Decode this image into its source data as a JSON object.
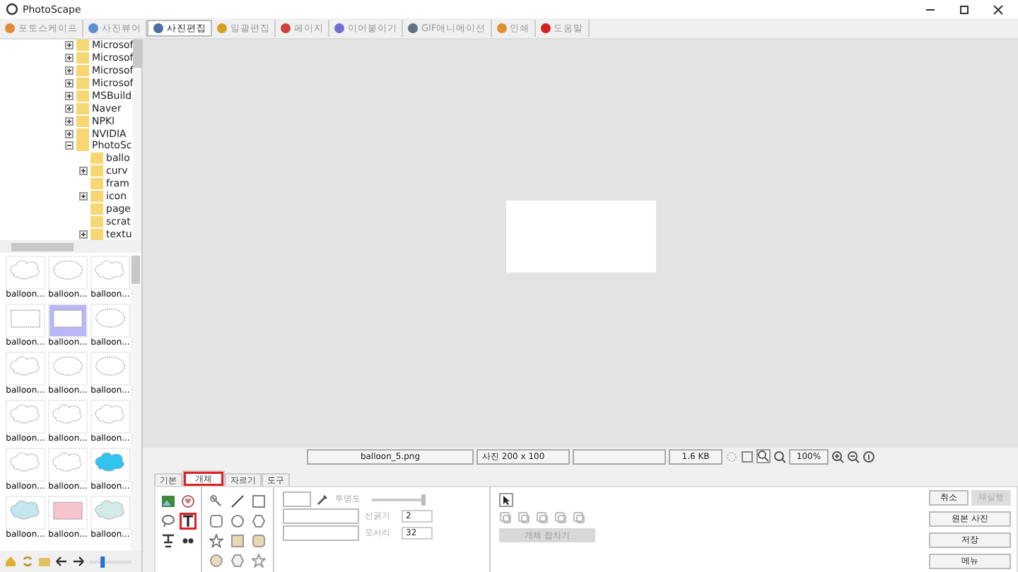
{
  "window": {
    "title": "PhotoScape"
  },
  "main_tabs": [
    {
      "label": "포토스케이프",
      "selected": false
    },
    {
      "label": "사진뷰어",
      "selected": false
    },
    {
      "label": "사진편집",
      "selected": true
    },
    {
      "label": "일괄편집",
      "selected": false
    },
    {
      "label": "페이지",
      "selected": false
    },
    {
      "label": "이어붙이기",
      "selected": false
    },
    {
      "label": "GIF애니메이션",
      "selected": false
    },
    {
      "label": "인쇄",
      "selected": false
    },
    {
      "label": "도움말",
      "selected": false
    }
  ],
  "folder_tree": [
    {
      "label": "Microsof",
      "kind": "collapsed"
    },
    {
      "label": "Microsof",
      "kind": "collapsed"
    },
    {
      "label": "Microsof",
      "kind": "collapsed"
    },
    {
      "label": "Microsof",
      "kind": "collapsed"
    },
    {
      "label": "MSBuild",
      "kind": "collapsed"
    },
    {
      "label": "Naver",
      "kind": "collapsed"
    },
    {
      "label": "NPKI",
      "kind": "collapsed"
    },
    {
      "label": "NVIDIA",
      "kind": "collapsed"
    },
    {
      "label": "PhotoSc",
      "kind": "expanded",
      "children": [
        {
          "label": "ballo",
          "kind": "leaf"
        },
        {
          "label": "curv",
          "kind": "collapsed"
        },
        {
          "label": "fram",
          "kind": "leaf"
        },
        {
          "label": "icon",
          "kind": "collapsed"
        },
        {
          "label": "page",
          "kind": "leaf"
        },
        {
          "label": "scrat",
          "kind": "leaf"
        },
        {
          "label": "textu",
          "kind": "collapsed"
        }
      ]
    }
  ],
  "thumbnails": [
    {
      "label": "balloon...",
      "kind": "cloud",
      "color": "#ffffff",
      "selected": false
    },
    {
      "label": "balloon...",
      "kind": "oval",
      "color": "#ffffff",
      "selected": false
    },
    {
      "label": "balloon...",
      "kind": "cloud",
      "color": "#ffffff",
      "selected": false
    },
    {
      "label": "balloon...",
      "kind": "rect",
      "color": "#ffffff",
      "selected": false
    },
    {
      "label": "balloon...",
      "kind": "rect",
      "color": "#ffffff",
      "selected": true
    },
    {
      "label": "balloon...",
      "kind": "oval",
      "color": "#ffffff",
      "selected": false
    },
    {
      "label": "balloon...",
      "kind": "cloud",
      "color": "#ffffff",
      "selected": false
    },
    {
      "label": "balloon...",
      "kind": "oval",
      "color": "#ffffff",
      "selected": false
    },
    {
      "label": "balloon...",
      "kind": "oval",
      "color": "#ffffff",
      "selected": false
    },
    {
      "label": "balloon...",
      "kind": "cloud",
      "color": "#ffffff",
      "selected": false
    },
    {
      "label": "balloon...",
      "kind": "cloud",
      "color": "#ffffff",
      "selected": false
    },
    {
      "label": "balloon...",
      "kind": "cloud",
      "color": "#ffffff",
      "selected": false
    },
    {
      "label": "balloon...",
      "kind": "cloud",
      "color": "#ffffff",
      "selected": false
    },
    {
      "label": "balloon...",
      "kind": "cloud",
      "color": "#ffffff",
      "selected": false
    },
    {
      "label": "balloon...",
      "kind": "cloud",
      "color": "#33c4ee",
      "selected": false
    },
    {
      "label": "balloon...",
      "kind": "cloud",
      "color": "#c4e6ee",
      "selected": false
    },
    {
      "label": "balloon...",
      "kind": "rect",
      "color": "#f7c3cd",
      "selected": false
    },
    {
      "label": "balloon...",
      "kind": "cloud",
      "color": "#d3ebe6",
      "selected": false
    }
  ],
  "thumbnail_size": {
    "level": 0.3
  },
  "status_bar": {
    "file": "balloon_5.png",
    "dimensions": "사진 200 x 100",
    "file_size": "1.6 KB",
    "zoom": "100%"
  },
  "editor_tabs": [
    {
      "label": "기본",
      "selected": false,
      "highlighted": false
    },
    {
      "label": "개체",
      "selected": true,
      "highlighted": true
    },
    {
      "label": "자르기",
      "selected": false,
      "highlighted": false
    },
    {
      "label": "도구",
      "selected": false,
      "highlighted": false
    }
  ],
  "text_tool": {
    "highlighted": true
  },
  "object_settings": {
    "opacity": {
      "label": "투명도",
      "level": 1
    },
    "line_width": {
      "label": "선굵기",
      "value": "2"
    },
    "corner": {
      "label": "모서리",
      "value": "32"
    }
  },
  "merge_button": {
    "label": "개체 합치기",
    "disabled": true
  },
  "action_buttons": [
    {
      "label": "취소",
      "disabled": false
    },
    {
      "label": "재실행",
      "disabled": true
    },
    {
      "label": "원본 사진",
      "disabled": false
    },
    {
      "label": "저장",
      "disabled": false
    },
    {
      "label": "메뉴",
      "disabled": false
    }
  ]
}
